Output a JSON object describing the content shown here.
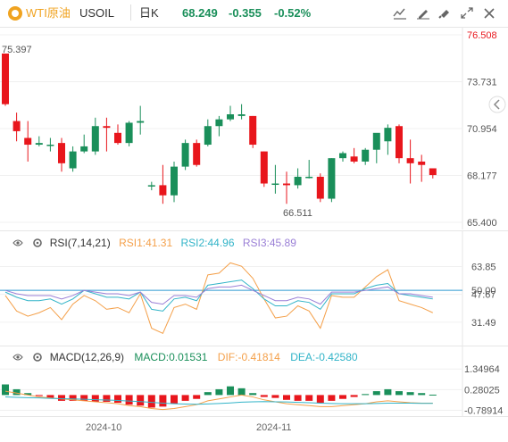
{
  "header": {
    "symbol_name": "WTI原油",
    "symbol_code": "USOIL",
    "interval": "日K",
    "last": "68.249",
    "change": "-0.355",
    "change_pct": "-0.52%",
    "up_color": "#1a8f5a",
    "down_color": "#e8161c",
    "icons": [
      "indicator-icon",
      "drawing-icon",
      "brush-icon",
      "fullscreen-icon",
      "close-icon"
    ]
  },
  "main_chart": {
    "y_ticks": [
      "76.508",
      "73.731",
      "70.954",
      "68.177",
      "65.400"
    ],
    "y_tick_values": [
      76.508,
      73.731,
      70.954,
      68.177,
      65.4
    ],
    "high_label": "75.397",
    "low_label": "66.511",
    "collapse_icon": "chevron-left-icon"
  },
  "rsi": {
    "title": "RSI(7,14,21)",
    "rsi1_label": "RSI1:41.31",
    "rsi2_label": "RSI2:44.96",
    "rsi3_label": "RSI3:45.89",
    "rsi1_color": "#f4a04a",
    "rsi2_color": "#32b4c8",
    "rsi3_color": "#9a7fd6",
    "y_ticks": [
      "63.85",
      "50.00",
      "47.67",
      "31.49"
    ],
    "y_tick_values": [
      63.85,
      50.0,
      47.67,
      31.49
    ],
    "current_value_label": "47.67"
  },
  "macd": {
    "title": "MACD(12,26,9)",
    "macd_label": "MACD:0.01531",
    "dif_label": "DIF:-0.41814",
    "dea_label": "DEA:-0.42580",
    "macd_color": "#1a8f5a",
    "dif_color": "#f4a04a",
    "dea_color": "#32b4c8",
    "y_ticks": [
      "1.34964",
      "0.28025",
      "-0.78914"
    ],
    "y_tick_values": [
      1.34964,
      0.28025,
      -0.78914
    ]
  },
  "x_axis": {
    "labels": [
      "2024-10",
      "2024-11"
    ]
  },
  "chart_data": {
    "type": "candlestick",
    "x_ticks": [
      "2024-10",
      "2024-11"
    ],
    "ohlc": [
      [
        75.4,
        75.4,
        72.3,
        72.4
      ],
      [
        71.4,
        71.9,
        70.2,
        70.8
      ],
      [
        70.4,
        71.4,
        69.0,
        70.0
      ],
      [
        70.0,
        70.5,
        69.9,
        70.1
      ],
      [
        70.0,
        70.4,
        69.6,
        70.0
      ],
      [
        70.1,
        70.4,
        68.4,
        68.9
      ],
      [
        68.6,
        69.9,
        68.4,
        69.6
      ],
      [
        69.6,
        70.6,
        69.5,
        69.9
      ],
      [
        69.6,
        71.6,
        69.4,
        71.1
      ],
      [
        71.1,
        71.6,
        69.6,
        71.0
      ],
      [
        70.7,
        71.2,
        70.0,
        70.1
      ],
      [
        70.1,
        71.4,
        69.9,
        71.3
      ],
      [
        71.3,
        72.3,
        70.6,
        71.4
      ],
      [
        67.6,
        67.8,
        67.3,
        67.6
      ],
      [
        67.6,
        68.8,
        66.5,
        67.0
      ],
      [
        67.0,
        69.0,
        66.6,
        68.7
      ],
      [
        68.7,
        70.3,
        68.5,
        70.1
      ],
      [
        70.1,
        70.3,
        68.7,
        68.8
      ],
      [
        70.0,
        71.5,
        69.9,
        71.1
      ],
      [
        71.1,
        71.7,
        70.5,
        71.5
      ],
      [
        71.5,
        72.3,
        71.4,
        71.8
      ],
      [
        71.7,
        72.4,
        71.5,
        71.8
      ],
      [
        71.7,
        71.7,
        69.8,
        70.0
      ],
      [
        69.6,
        69.6,
        67.5,
        67.7
      ],
      [
        67.7,
        68.8,
        67.1,
        67.7
      ],
      [
        67.7,
        68.4,
        66.5,
        67.6
      ],
      [
        67.6,
        68.6,
        67.4,
        68.1
      ],
      [
        68.1,
        69.1,
        68.0,
        68.1
      ],
      [
        68.1,
        68.3,
        66.6,
        66.8
      ],
      [
        66.8,
        69.2,
        66.6,
        69.2
      ],
      [
        69.2,
        69.6,
        69.0,
        69.5
      ],
      [
        69.3,
        69.8,
        68.9,
        69.0
      ],
      [
        69.0,
        69.8,
        68.8,
        69.7
      ],
      [
        69.7,
        70.5,
        68.9,
        70.7
      ],
      [
        70.2,
        71.2,
        69.4,
        71.0
      ],
      [
        71.1,
        71.2,
        68.9,
        69.2
      ],
      [
        69.2,
        70.3,
        67.7,
        68.9
      ],
      [
        69.0,
        69.4,
        67.8,
        68.8
      ],
      [
        68.6,
        68.6,
        68.0,
        68.2
      ]
    ],
    "rsi1": [
      47,
      38,
      35,
      37,
      40,
      33,
      42,
      47,
      44,
      39,
      40,
      37,
      48,
      28,
      25,
      40,
      42,
      39,
      59,
      60,
      66,
      64,
      57,
      45,
      34,
      35,
      41,
      38,
      28,
      47,
      46,
      46,
      52,
      58,
      62,
      44,
      42,
      40,
      37
    ],
    "rsi2": [
      49,
      46,
      44,
      44,
      45,
      42,
      45,
      50,
      48,
      46,
      46,
      45,
      49,
      39,
      38,
      45,
      46,
      44,
      53,
      54,
      55,
      56,
      51,
      45,
      41,
      41,
      44,
      43,
      39,
      48,
      48,
      48,
      51,
      53,
      54,
      48,
      47,
      46,
      45
    ],
    "rsi3": [
      50,
      48,
      47,
      47,
      47,
      45,
      47,
      50,
      49,
      48,
      48,
      47,
      49,
      43,
      42,
      47,
      47,
      46,
      51,
      52,
      52,
      53,
      50,
      47,
      44,
      44,
      46,
      45,
      42,
      49,
      49,
      49,
      50,
      51,
      52,
      48,
      48,
      47,
      46
    ],
    "macd_hist": [
      0.55,
      0.3,
      0.1,
      -0.05,
      -0.15,
      -0.3,
      -0.3,
      -0.3,
      -0.35,
      -0.35,
      -0.4,
      -0.5,
      -0.55,
      -0.65,
      -0.6,
      -0.45,
      -0.3,
      -0.2,
      0.15,
      0.3,
      0.45,
      0.35,
      0.1,
      -0.1,
      -0.15,
      -0.25,
      -0.3,
      -0.3,
      -0.4,
      -0.3,
      -0.2,
      -0.1,
      0.05,
      0.2,
      0.3,
      0.2,
      0.15,
      0.1,
      0.02
    ],
    "dif": [
      0.2,
      0.1,
      0.0,
      -0.1,
      -0.15,
      -0.2,
      -0.25,
      -0.3,
      -0.35,
      -0.4,
      -0.45,
      -0.55,
      -0.6,
      -0.7,
      -0.75,
      -0.7,
      -0.6,
      -0.5,
      -0.3,
      -0.2,
      -0.1,
      0.0,
      -0.1,
      -0.25,
      -0.35,
      -0.45,
      -0.5,
      -0.55,
      -0.6,
      -0.6,
      -0.55,
      -0.5,
      -0.45,
      -0.35,
      -0.3,
      -0.35,
      -0.4,
      -0.42,
      -0.42
    ],
    "dea": [
      -0.1,
      -0.12,
      -0.14,
      -0.15,
      -0.17,
      -0.19,
      -0.2,
      -0.22,
      -0.24,
      -0.26,
      -0.28,
      -0.31,
      -0.34,
      -0.38,
      -0.42,
      -0.45,
      -0.47,
      -0.48,
      -0.46,
      -0.44,
      -0.41,
      -0.37,
      -0.35,
      -0.34,
      -0.35,
      -0.36,
      -0.38,
      -0.4,
      -0.42,
      -0.44,
      -0.45,
      -0.45,
      -0.45,
      -0.44,
      -0.42,
      -0.42,
      -0.42,
      -0.43,
      -0.43
    ],
    "rsi_ylim": [
      20,
      75
    ],
    "macd_ylim": [
      -1.0,
      1.5
    ],
    "price_ylim": [
      65.4,
      76.508
    ]
  }
}
